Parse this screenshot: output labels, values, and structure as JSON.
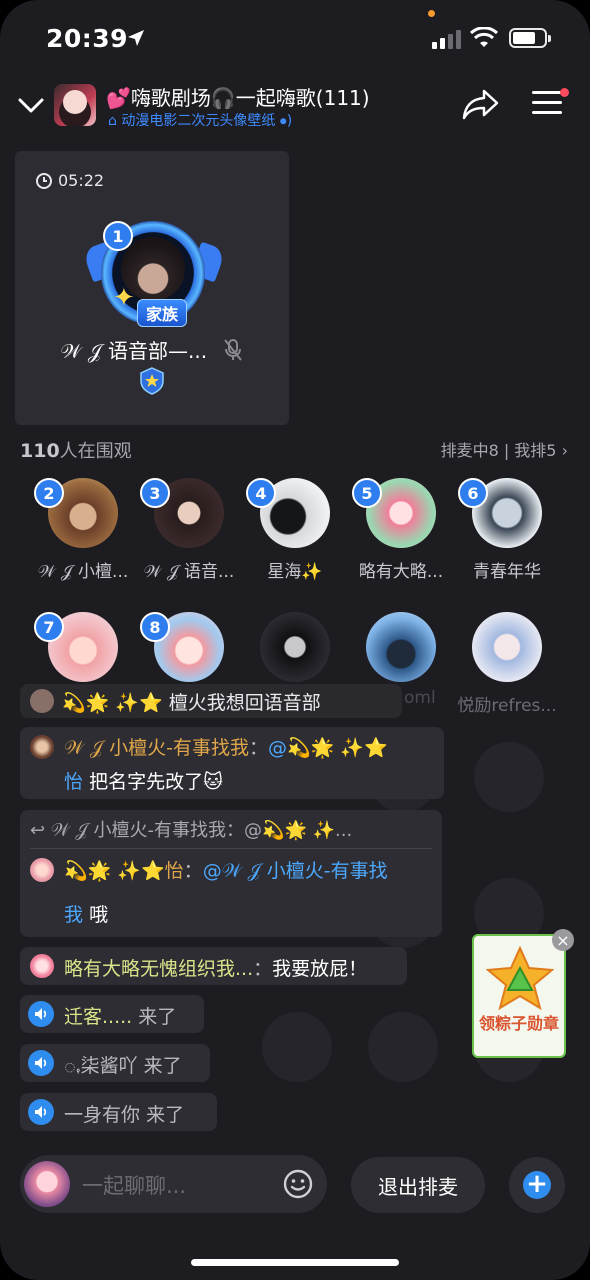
{
  "status_bar": {
    "time": "20:39"
  },
  "header": {
    "title": "💕嗨歌剧场🎧一起嗨歌(111)",
    "subtitle": "动漫电影二次元头像壁纸"
  },
  "host": {
    "timer": "05:22",
    "seat_number": "1",
    "badge": "家族",
    "name": "𝒲 𝒥 语音部—..."
  },
  "audience": {
    "count": "110",
    "label": "人在围观",
    "queue": "排麦中8 | 我排5"
  },
  "seats": [
    {
      "num": "2",
      "name": "𝒲 𝒥 小檀..."
    },
    {
      "num": "3",
      "name": "𝒲 𝒥 语音..."
    },
    {
      "num": "4",
      "name": "星海✨"
    },
    {
      "num": "5",
      "name": "略有大略..."
    },
    {
      "num": "6",
      "name": "青春年华"
    },
    {
      "num": "7",
      "name": ""
    },
    {
      "num": "8",
      "name": ""
    },
    {
      "num": "",
      "name": ""
    },
    {
      "num": "",
      "name": ""
    },
    {
      "num": "",
      "name": "悦励refres..."
    }
  ],
  "overlay": {
    "partial_msg": "💫🌟 ✨⭐ 檀火我想回语音部",
    "partial_tail": "oml"
  },
  "chat": {
    "m1_user": "𝒲 𝒥 小檀火-有事找我",
    "m1_sep": "：",
    "m1_at": "@💫🌟 ✨⭐",
    "m1_at2": "怡",
    "m1_text": "把名字先改了🐱",
    "m2_quote": "𝒲 𝒥 小檀火-有事找我：@💫🌟 ✨...",
    "m2_user": "💫🌟 ✨⭐怡",
    "m2_sep": "：",
    "m2_at": "@𝒲 𝒥 小檀火-有事找",
    "m2_at2": "我",
    "m2_text": "哦",
    "m3_user": "略有大略无愧组织我...",
    "m3_sep": "：",
    "m3_text": "我要放屁！",
    "j1_name": "迁客.....",
    "j1_text": "来了",
    "j2_name": "ꩻ柒酱吖",
    "j2_text": "来了",
    "j3_name": "一身有你",
    "j3_text": "来了"
  },
  "float_card": {
    "label": "领粽子勋章",
    "close": "×"
  },
  "bottom": {
    "placeholder": "一起聊聊...",
    "exit_label": "退出排麦",
    "plus": "+"
  }
}
